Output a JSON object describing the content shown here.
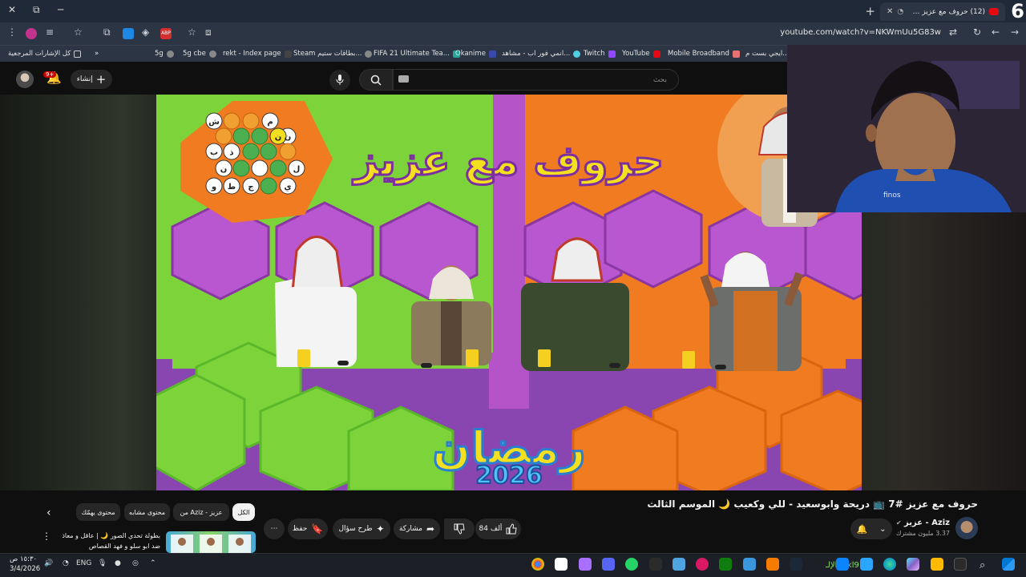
{
  "browser": {
    "tab_title": "(12) حروف مع عزيز #7 د",
    "tab_count": "6",
    "url": "youtube.com/watch?v=NKWmUu5G83w",
    "bookmarks": [
      "ايجي بست م...",
      "Mobile Broadband",
      "YouTube",
      "Twitch",
      "انمي فور اب - مشاهد...",
      "Okanime",
      "FIFA 21 Ultimate Tea...",
      "Steam بطاقات ستيم...",
      "rekt - Index page",
      "5g cbe",
      "5g"
    ],
    "all_bookmarks": "كل الإشارات المرجعية"
  },
  "youtube": {
    "notif_badge": "9+",
    "create_label": "إنشاء",
    "search_placeholder": "بحث"
  },
  "video": {
    "title": "حروف مع عزيز #7 📺 دريحة وابوسعيد - للي وكعيب 🌙 الموسم الثالث",
    "logo_text": "حروف مع عزيز",
    "ramadan_text": "رمضان",
    "year_text": "2026",
    "board_letters": [
      "ش",
      "م",
      "ن",
      "ن",
      "ب",
      "ذ",
      "ن",
      "ن",
      "ي",
      "غ",
      "ص",
      "ل",
      "و",
      "ط",
      "ج"
    ]
  },
  "channel": {
    "name": "Aziz - عزيز",
    "subscribers": "3.37 مليون مشترك"
  },
  "actions": {
    "likes": "84 ألف",
    "share": "مشاركة",
    "ask": "طرح سؤال",
    "save": "حفظ"
  },
  "chips": [
    "الكل",
    "من Aziz - عزيز",
    "محتوى مشابه",
    "محتوى يهمّك"
  ],
  "recommended": {
    "title": "بطولة تحدي الصور 🌙 | عاقل و معاذ ضد ابو سلو و فهد القصاص"
  },
  "taskbar": {
    "time": "١٥:٣٠ ص",
    "date": "3/4/2026",
    "lang": "ENG",
    "label": "الإلـ : lkl911"
  }
}
